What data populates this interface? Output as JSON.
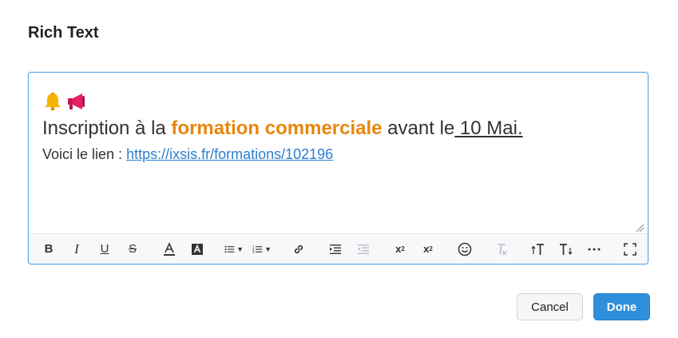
{
  "dialog": {
    "title": "Rich Text"
  },
  "editor": {
    "emojis": [
      "bell-icon",
      "megaphone-icon"
    ],
    "line1": {
      "prefix": "Inscription à la ",
      "highlight": "formation commerciale",
      "middle": " avant le",
      "date": " 10 Mai."
    },
    "line2": {
      "label": "Voici le lien : ",
      "link": "https://ixsis.fr/formations/102196"
    },
    "highlight_color": "#e8860c",
    "link_color": "#2b7ed0"
  },
  "toolbar": {
    "groups": [
      [
        "bold",
        "italic",
        "underline",
        "strikethrough"
      ],
      [
        "font-color",
        "background-color"
      ],
      [
        "bullet-list",
        "numbered-list"
      ],
      [
        "link"
      ],
      [
        "indent",
        "outdent"
      ],
      [
        "subscript",
        "superscript"
      ],
      [
        "emoji"
      ],
      [
        "clear-format"
      ],
      [
        "font-size",
        "line-height",
        "more",
        "fullscreen"
      ]
    ]
  },
  "actions": {
    "cancel_label": "Cancel",
    "done_label": "Done",
    "done_color": "#2e8fdc"
  }
}
